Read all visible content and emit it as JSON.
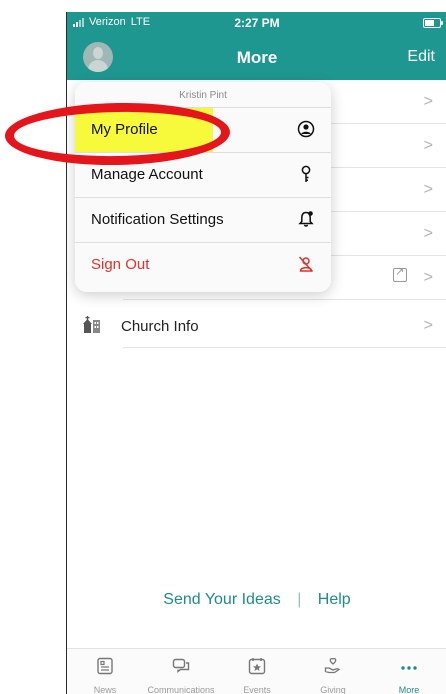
{
  "status_bar": {
    "carrier": "Verizon",
    "network": "LTE",
    "time": "2:27 PM"
  },
  "nav": {
    "title": "More",
    "edit_label": "Edit"
  },
  "menu": {
    "user_name": "Kristin Pint",
    "items": [
      {
        "label": "My Profile",
        "icon": "profile-icon"
      },
      {
        "label": "Manage Account",
        "icon": "key-icon"
      },
      {
        "label": "Notification Settings",
        "icon": "bell-icon"
      },
      {
        "label": "Sign Out",
        "icon": "sign-out-icon"
      }
    ]
  },
  "list": {
    "church_info_label": "Church Info"
  },
  "footer": {
    "ideas_label": "Send Your Ideas",
    "separator": "|",
    "help_label": "Help"
  },
  "tabs": [
    {
      "label": "News",
      "icon": "news-icon"
    },
    {
      "label": "Communications",
      "icon": "chat-icon"
    },
    {
      "label": "Events",
      "icon": "calendar-star-icon"
    },
    {
      "label": "Giving",
      "icon": "giving-hand-icon"
    },
    {
      "label": "More",
      "icon": "more-dots-icon"
    }
  ],
  "colors": {
    "header": "#1e9790",
    "accent": "#1f8d86",
    "danger": "#e0322b",
    "highlight": "#f6fa3a",
    "annotation": "#e4161b"
  }
}
